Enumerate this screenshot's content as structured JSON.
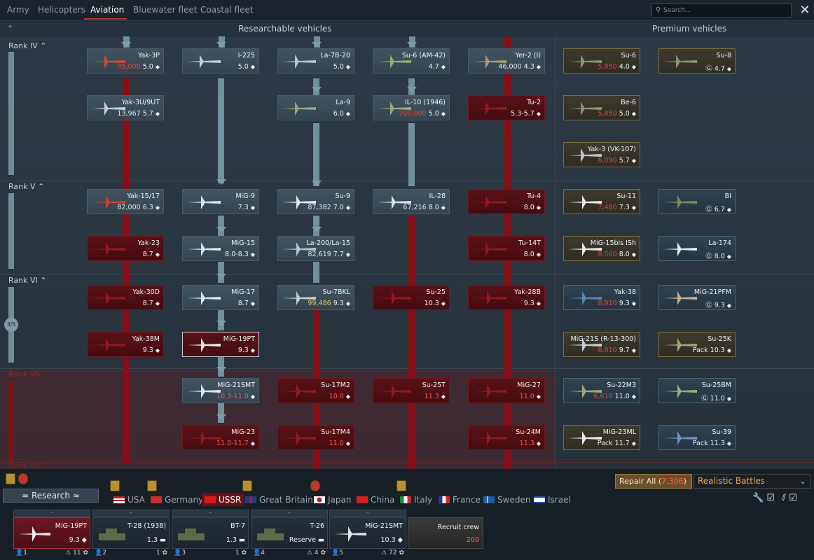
{
  "top_tabs": [
    "Army",
    "Helicopters",
    "Aviation",
    "Bluewater fleet",
    "Coastal fleet"
  ],
  "active_tab": "Aviation",
  "search_placeholder": "Search...",
  "headers": {
    "research": "Researchable vehicles",
    "premium": "Premium vehicles"
  },
  "ranks": [
    "Rank IV",
    "Rank V",
    "Rank VI",
    "Rank VII",
    "Rank VIII"
  ],
  "rank_progress": "3/5",
  "vehicles": {
    "yak3p": {
      "name": "Yak-3P",
      "cost": "35,000",
      "br": "5.0"
    },
    "yak3u": {
      "name": "Yak-3U/9UT",
      "rp": "13,967",
      "br": "5.7"
    },
    "yak1517": {
      "name": "Yak-15/17",
      "rp": "82,000",
      "br": "6.3"
    },
    "yak23": {
      "name": "Yak-23",
      "br": "8.7"
    },
    "yak30d": {
      "name": "Yak-30D",
      "br": "8.7"
    },
    "yak38m": {
      "name": "Yak-38M",
      "br": "9.3"
    },
    "i225": {
      "name": "I-225",
      "br": "5.0"
    },
    "mig9": {
      "name": "MiG-9",
      "br": "7.3"
    },
    "mig15": {
      "name": "MiG-15",
      "br": "8.0-8.3"
    },
    "mig17": {
      "name": "MiG-17",
      "br": "8.7"
    },
    "mig19pt": {
      "name": "MiG-19PT",
      "br": "9.3"
    },
    "mig21smt": {
      "name": "MiG-21SMT",
      "br": "10.3-11.0"
    },
    "mig23": {
      "name": "MiG-23",
      "br": "11.0-11.7"
    },
    "la7b20": {
      "name": "La-7B-20",
      "br": "5.0"
    },
    "la9": {
      "name": "La-9",
      "br": "6.0"
    },
    "su9": {
      "name": "Su-9",
      "rp": "87,382",
      "br": "7.0"
    },
    "la200": {
      "name": "La-200/La-15",
      "rp": "82,619",
      "br": "7.7"
    },
    "su7bkl": {
      "name": "Su-7BKL",
      "rp": "99,486",
      "br": "9.3"
    },
    "su17m2": {
      "name": "Su-17M2",
      "br": "10.0"
    },
    "su17m4": {
      "name": "Su-17M4",
      "br": "11.0"
    },
    "su6": {
      "name": "Su-6 (AM-42)",
      "br": "4.7"
    },
    "il10": {
      "name": "IL-10 (1946)",
      "cost": "200,000",
      "br": "5.0"
    },
    "il28": {
      "name": "IL-28",
      "rp": "67,216",
      "br": "8.0"
    },
    "su25": {
      "name": "Su-25",
      "br": "10.3"
    },
    "su25t": {
      "name": "Su-25T",
      "br": "11.3"
    },
    "yer2": {
      "name": "Yer-2 (I)",
      "rp": "46,000",
      "br": "4.3"
    },
    "tu2": {
      "name": "Tu-2",
      "br": "5.3-5.7"
    },
    "tu4": {
      "name": "Tu-4",
      "br": "8.0"
    },
    "tu14t": {
      "name": "Tu-14T",
      "br": "8.0"
    },
    "yak28b": {
      "name": "Yak-28B",
      "br": "9.3"
    },
    "mig27": {
      "name": "MiG-27",
      "br": "11.0"
    },
    "su24m": {
      "name": "Su-24M",
      "br": "11.3"
    },
    "p_su6": {
      "name": "Su-6",
      "cost": "5,850",
      "br": "4.0"
    },
    "p_su8": {
      "name": "Su-8",
      "br": "4.7"
    },
    "p_be6": {
      "name": "Be-6",
      "cost": "5,850",
      "br": "5.0"
    },
    "p_yak3vk": {
      "name": "Yak-3 (VK-107)",
      "cost": "6,090",
      "br": "5.7"
    },
    "p_su11": {
      "name": "Su-11",
      "cost": "7,480",
      "br": "7.3"
    },
    "p_bi": {
      "name": "BI",
      "br": "6.7"
    },
    "p_mig15bis": {
      "name": "MiG-15bis ISh",
      "cost": "8,560",
      "br": "8.0"
    },
    "p_la174": {
      "name": "La-174",
      "br": "8.0"
    },
    "p_yak38": {
      "name": "Yak-38",
      "cost": "8,910",
      "br": "9.3"
    },
    "p_mig21pfm": {
      "name": "MiG-21PFM",
      "br": "9.3"
    },
    "p_mig21s": {
      "name": "MiG-21S (R-13-300)",
      "cost": "8,910",
      "br": "9.7"
    },
    "p_su25k": {
      "name": "Su-25K",
      "pack": "Pack",
      "br": "10.3"
    },
    "p_su22m3": {
      "name": "Su-22M3",
      "cost": "6,610",
      "br": "11.0"
    },
    "p_su25bm": {
      "name": "Su-25BM",
      "br": "11.0"
    },
    "p_mig23ml": {
      "name": "MiG-23ML",
      "pack": "Pack",
      "br": "11.7"
    },
    "p_su39": {
      "name": "Su-39",
      "pack": "Pack",
      "br": "11.3"
    }
  },
  "repair": {
    "label": "Repair All (",
    "amount": "7,306",
    "suffix": ")"
  },
  "game_mode": "Realistic Battles",
  "research_label": "Research",
  "nations": [
    "USA",
    "Germany",
    "USSR",
    "Great Britain",
    "Japan",
    "China",
    "Italy",
    "France",
    "Sweden",
    "Israel"
  ],
  "active_nation": "USSR",
  "crew_slots": [
    {
      "name": "MiG-19PT",
      "br": "9.3",
      "num": "1",
      "crew": "11"
    },
    {
      "name": "T-28 (1938)",
      "br": "1.3",
      "num": "2",
      "crew": "1"
    },
    {
      "name": "BT-7",
      "br": "1.3",
      "num": "3",
      "crew": "1"
    },
    {
      "name": "T-26",
      "br": "Reserve",
      "num": "4",
      "crew": "4"
    },
    {
      "name": "MiG-21SMT",
      "br": "10.3",
      "num": "5",
      "crew": "72"
    }
  ],
  "recruit": {
    "label": "Recruit crew",
    "cost": "200"
  },
  "colors": {
    "accent_red": "#b7332d",
    "locked": "#5a1118",
    "researched": "#41545f",
    "premium": "#3d3a2e"
  }
}
